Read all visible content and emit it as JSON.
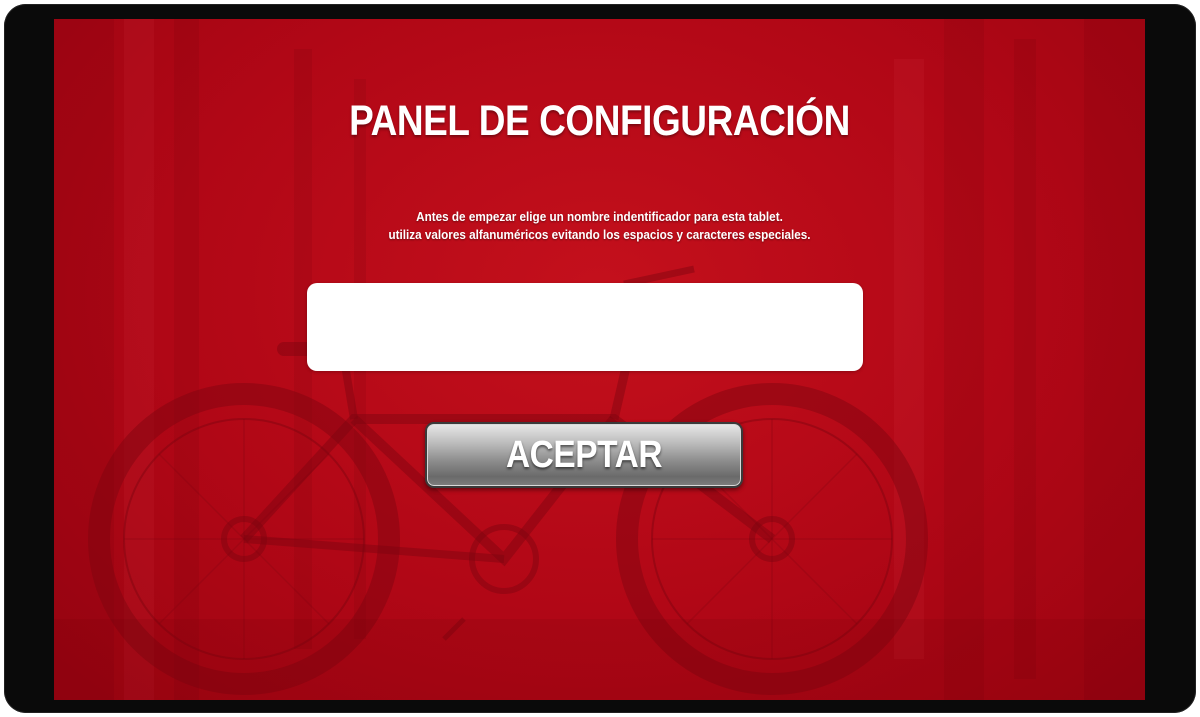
{
  "panel": {
    "title": "PANEL DE CONFIGURACIÓN",
    "instructions": {
      "line1": "Antes de empezar elige un nombre indentificador para esta tablet.",
      "line2": "utiliza valores alfanuméricos evitando los espacios y caracteres especiales."
    },
    "name_input": {
      "value": "",
      "placeholder": ""
    },
    "accept_label": "ACEPTAR"
  },
  "colors": {
    "background_red": "#b10716",
    "device_frame": "#0a0a0a",
    "text": "#ffffff",
    "button_gray": "#9a9a9a"
  },
  "background_image": "bicycle-photo"
}
